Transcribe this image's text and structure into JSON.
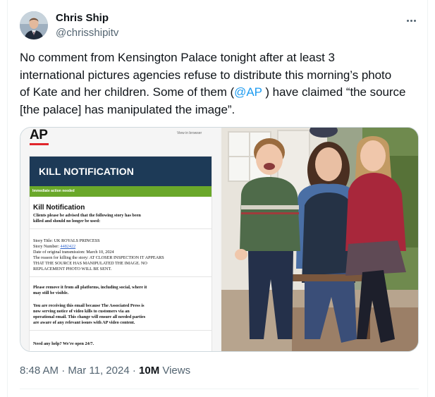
{
  "author": {
    "name": "Chris Ship",
    "handle": "@chrisshipitv",
    "avatar_icon": "person-avatar-icon"
  },
  "more_icon": "more-horizontal-icon",
  "tweet": {
    "line1": "No comment from Kensington Palace tonight after at least 3",
    "line2": "international pictures agencies refuse to distribute this morning’s photo",
    "line3": "of Kate and her children.  Some of them (",
    "mention": "@AP",
    "line3_after": " ) have claimed “the source",
    "line4": "[the palace] has manipulated the image”."
  },
  "media": {
    "email": {
      "logo": "AP",
      "view_in_browser": "View in browser",
      "banner": "KILL NOTIFICATION",
      "action_bar": "Immediate action needed",
      "heading": "Kill Notification",
      "intro_1": "Clients please be advised that the following story has been",
      "intro_2": "killed and should no longer be used:",
      "story_title": "Story Title: UK ROYALS PRINCESS",
      "story_number_label": "Story Number: ",
      "story_number": "4482422",
      "original_date": "Date of original transmission: March 10, 2024",
      "reason_1": "The reason for killing the story: AT CLOSER INSPECTION IT APPEARS",
      "reason_2": "THAT THE SOURCE HAS MANIPULATED THE IMAGE. NO",
      "reason_3": "REPLACEMENT PHOTO WILL BE SENT.",
      "remove_1": "Please remove it from all platforms, including social, where it",
      "remove_2": "may still be visible.",
      "notice_1": "You are receiving this email because The Associated Press is",
      "notice_2": "now serving notice of video kills to customers via an",
      "notice_3": "operational email. This change will ensure all needed parties",
      "notice_4": "are aware of any relevant issues with AP video content.",
      "help": "Need any help? We're open 24/7."
    },
    "photo": {
      "colors": {
        "sweater_green": "#4f6b4a",
        "sweater_red": "#a8273b",
        "shirt_blue": "#4a6fa5",
        "jeans": "#3a4e78"
      }
    }
  },
  "footer": {
    "time": "8:48 AM",
    "separator": " · ",
    "date": "Mar 11, 2024",
    "separator2": " · ",
    "views_count": "10M",
    "views_label": " Views"
  }
}
